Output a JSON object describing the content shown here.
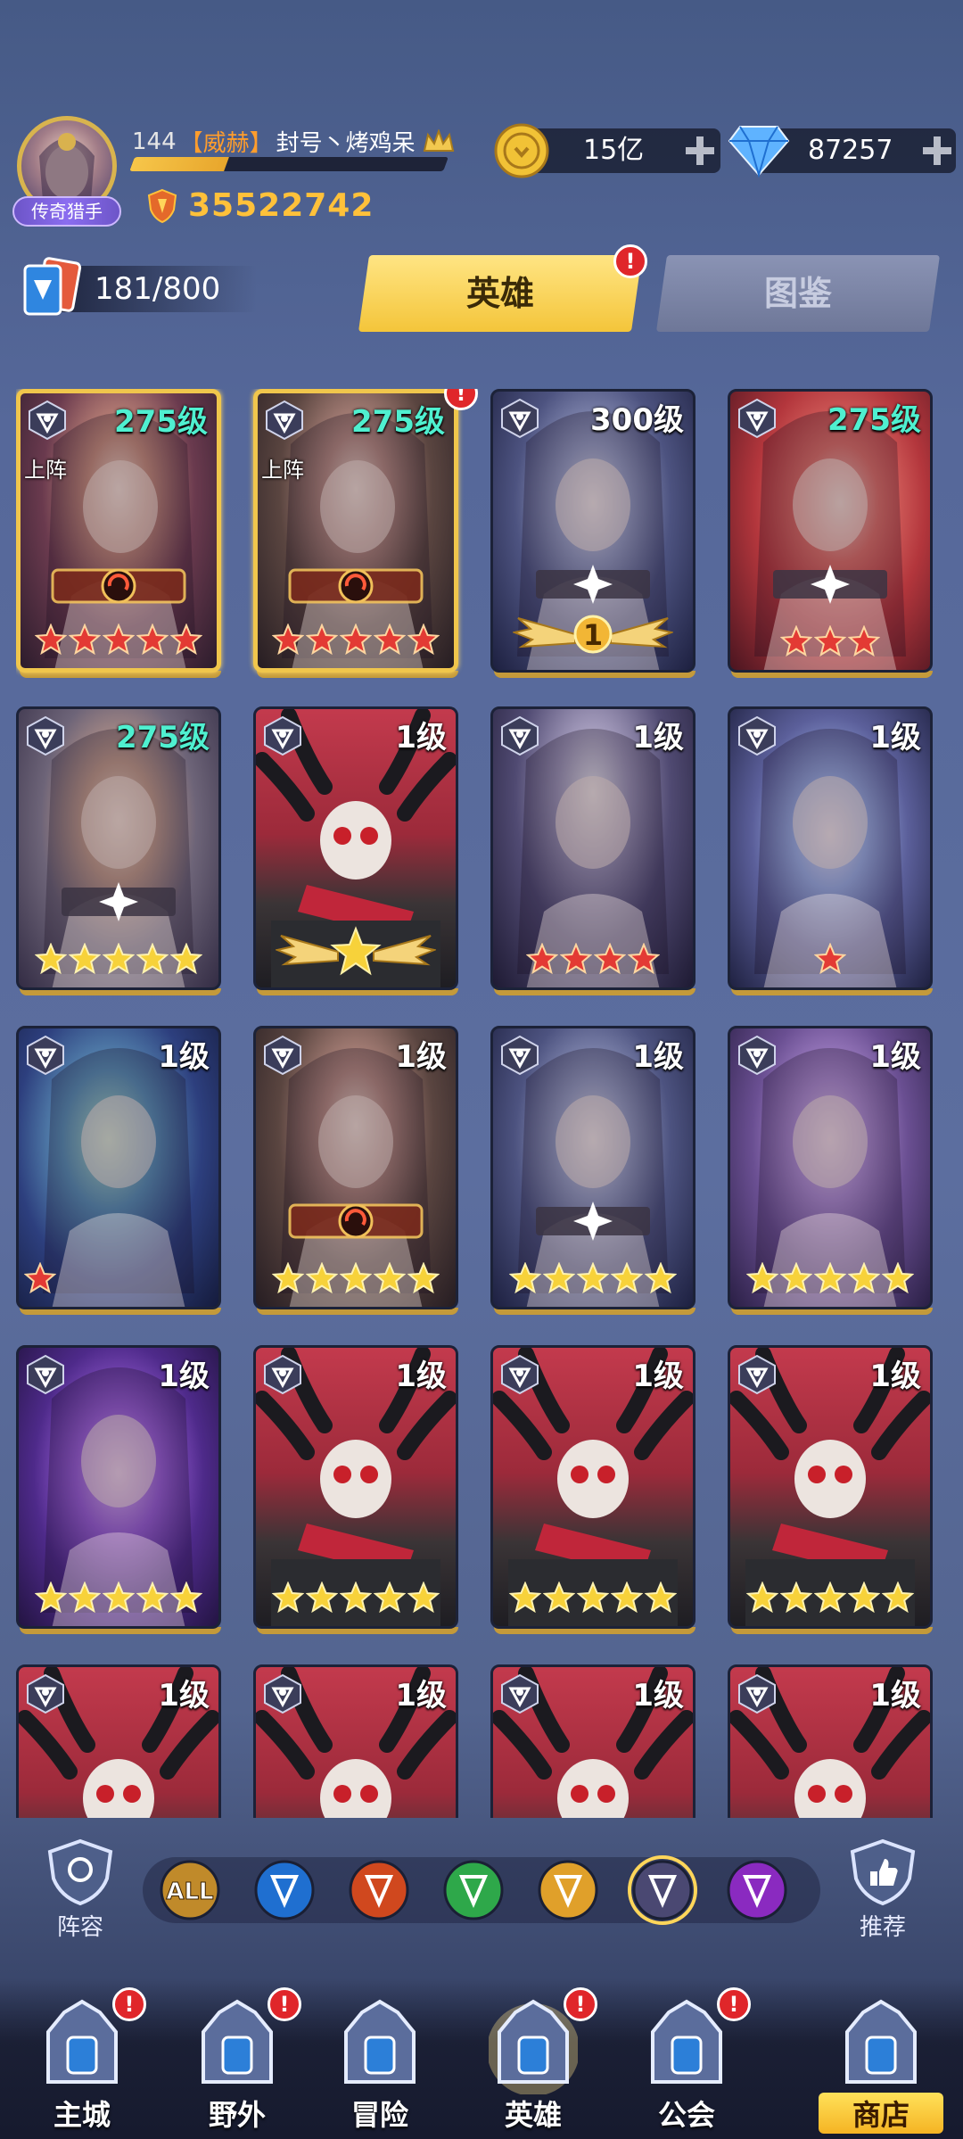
{
  "player": {
    "level": "144",
    "guild_tag": "【威赫】",
    "name": "封号丶烤鸡呆",
    "title": "传奇猎手",
    "xp_fraction": 0.3,
    "power": "35522742"
  },
  "resources": {
    "gold": "15亿",
    "diamonds": "87257"
  },
  "hero_count": "181/800",
  "tabs": [
    {
      "label": "英雄",
      "active": true,
      "badge": "!"
    },
    {
      "label": "图鉴",
      "active": false
    }
  ],
  "deploy_label": "上阵",
  "heroes": [
    {
      "level": "275级",
      "lvl_color": "#4ff0d0",
      "deployed": true,
      "badge": false,
      "art": "art-a",
      "stars": 5,
      "star_color": "red",
      "frame": "gold",
      "emblem": "red"
    },
    {
      "level": "275级",
      "lvl_color": "#4ff0d0",
      "deployed": true,
      "badge": true,
      "art": "art-b",
      "stars": 5,
      "star_color": "red",
      "frame": "gold",
      "emblem": "red"
    },
    {
      "level": "300级",
      "lvl_color": "#ffffff",
      "deployed": false,
      "badge": false,
      "art": "art-c",
      "stars": 0,
      "star_color": "none",
      "frame": "plain",
      "emblem": "white",
      "wing_number": "1"
    },
    {
      "level": "275级",
      "lvl_color": "#4ff0d0",
      "deployed": false,
      "badge": false,
      "art": "art-d",
      "stars": 3,
      "star_color": "red",
      "frame": "plain",
      "emblem": "white"
    },
    {
      "level": "275级",
      "lvl_color": "#4ff0d0",
      "deployed": false,
      "badge": false,
      "art": "art-e",
      "stars": 5,
      "star_color": "gold",
      "frame": "plain",
      "emblem": "white"
    },
    {
      "level": "1级",
      "lvl_color": "#ffffff",
      "deployed": false,
      "badge": false,
      "art": "art-f",
      "stars": 0,
      "star_color": "none",
      "frame": "plain",
      "emblem": "none",
      "wing_star": true
    },
    {
      "level": "1级",
      "lvl_color": "#ffffff",
      "deployed": false,
      "badge": false,
      "art": "art-g",
      "stars": 4,
      "star_color": "red",
      "frame": "plain",
      "emblem": "none"
    },
    {
      "level": "1级",
      "lvl_color": "#ffffff",
      "deployed": false,
      "badge": false,
      "art": "art-h",
      "stars": 1,
      "star_color": "red",
      "frame": "plain",
      "emblem": "none"
    },
    {
      "level": "1级",
      "lvl_color": "#ffffff",
      "deployed": false,
      "badge": false,
      "art": "art-i",
      "stars": 1,
      "star_color": "red",
      "frame": "plain",
      "emblem": "none",
      "stars_left": true
    },
    {
      "level": "1级",
      "lvl_color": "#ffffff",
      "deployed": false,
      "badge": false,
      "art": "art-b",
      "stars": 5,
      "star_color": "gold",
      "frame": "plain",
      "emblem": "red"
    },
    {
      "level": "1级",
      "lvl_color": "#ffffff",
      "deployed": false,
      "badge": false,
      "art": "art-c",
      "stars": 5,
      "star_color": "gold",
      "frame": "plain",
      "emblem": "white"
    },
    {
      "level": "1级",
      "lvl_color": "#ffffff",
      "deployed": false,
      "badge": false,
      "art": "art-j",
      "stars": 5,
      "star_color": "gold",
      "frame": "plain",
      "emblem": "none"
    },
    {
      "level": "1级",
      "lvl_color": "#ffffff",
      "deployed": false,
      "badge": false,
      "art": "art-k",
      "stars": 5,
      "star_color": "gold",
      "frame": "plain",
      "emblem": "none"
    },
    {
      "level": "1级",
      "lvl_color": "#ffffff",
      "deployed": false,
      "badge": false,
      "art": "art-f",
      "stars": 5,
      "star_color": "gold",
      "frame": "plain",
      "emblem": "none"
    },
    {
      "level": "1级",
      "lvl_color": "#ffffff",
      "deployed": false,
      "badge": false,
      "art": "art-f",
      "stars": 5,
      "star_color": "gold",
      "frame": "plain",
      "emblem": "none"
    },
    {
      "level": "1级",
      "lvl_color": "#ffffff",
      "deployed": false,
      "badge": false,
      "art": "art-f",
      "stars": 5,
      "star_color": "gold",
      "frame": "plain",
      "emblem": "none"
    },
    {
      "level": "1级",
      "lvl_color": "#ffffff",
      "deployed": false,
      "badge": false,
      "art": "art-f",
      "stars": 0,
      "star_color": "none",
      "frame": "plain",
      "emblem": "none"
    },
    {
      "level": "1级",
      "lvl_color": "#ffffff",
      "deployed": false,
      "badge": false,
      "art": "art-f",
      "stars": 0,
      "star_color": "none",
      "frame": "plain",
      "emblem": "none"
    },
    {
      "level": "1级",
      "lvl_color": "#ffffff",
      "deployed": false,
      "badge": false,
      "art": "art-f",
      "stars": 0,
      "star_color": "none",
      "frame": "plain",
      "emblem": "none"
    },
    {
      "level": "1级",
      "lvl_color": "#ffffff",
      "deployed": false,
      "badge": false,
      "art": "art-f",
      "stars": 0,
      "star_color": "none",
      "frame": "plain",
      "emblem": "none"
    }
  ],
  "filter_bar": {
    "left_label": "阵容",
    "right_label": "推荐",
    "filters": [
      {
        "name": "all",
        "label": "ALL",
        "color": "#c08a2a"
      },
      {
        "name": "water",
        "label": "",
        "color": "#1f6fd0"
      },
      {
        "name": "fire",
        "label": "",
        "color": "#d0481e"
      },
      {
        "name": "wind",
        "label": "",
        "color": "#2ea84a"
      },
      {
        "name": "light",
        "label": "",
        "color": "#e0a02a"
      },
      {
        "name": "dark",
        "label": "",
        "color": "#4a4872",
        "selected": true
      },
      {
        "name": "void",
        "label": "",
        "color": "#8a2ac0"
      }
    ]
  },
  "nav": [
    {
      "label": "主城",
      "badge": true,
      "active": false
    },
    {
      "label": "野外",
      "badge": true,
      "active": false
    },
    {
      "label": "冒险",
      "badge": false,
      "active": false
    },
    {
      "label": "英雄",
      "badge": true,
      "active": true
    },
    {
      "label": "公会",
      "badge": true,
      "active": false
    },
    {
      "label": "商店",
      "badge": false,
      "active": false
    }
  ]
}
